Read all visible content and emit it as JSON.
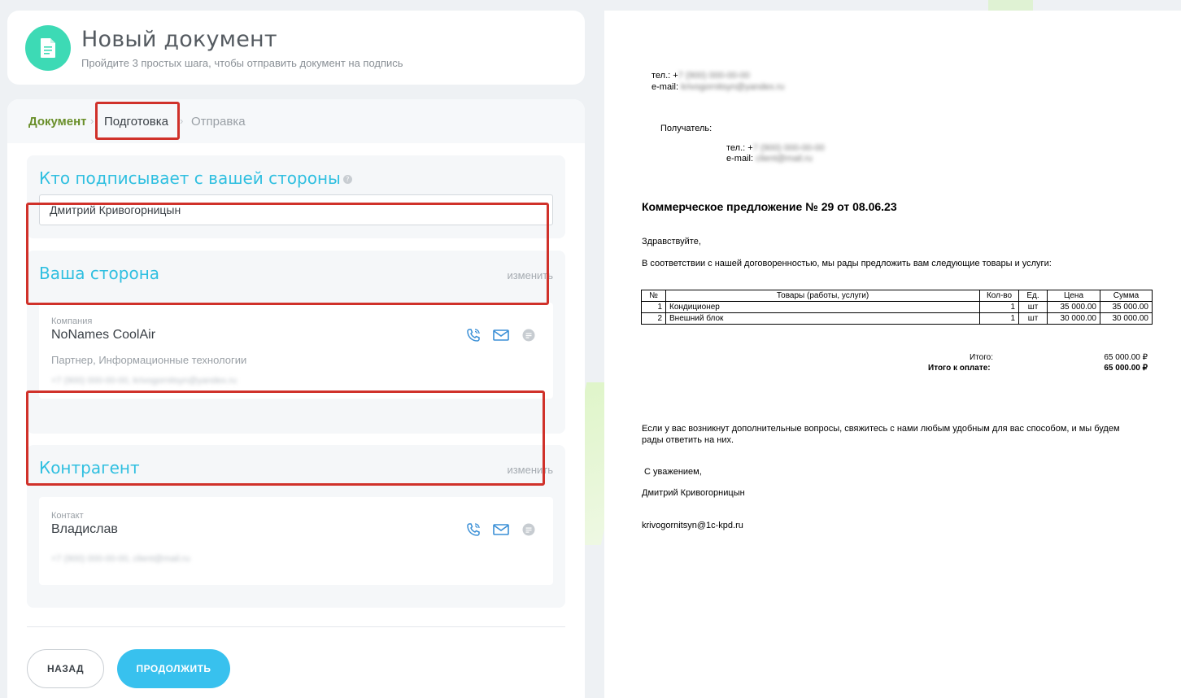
{
  "header": {
    "title": "Новый документ",
    "subtitle": "Пройдите 3 простых шага, чтобы отправить документ на подпись"
  },
  "tabs": [
    {
      "label": "Документ",
      "state": "done"
    },
    {
      "label": "Подготовка",
      "state": "active"
    },
    {
      "label": "Отправка",
      "state": "pending"
    }
  ],
  "tab_separator": "›",
  "signer": {
    "title": "Кто подписывает с вашей стороны",
    "help_icon": "?",
    "value": "Дмитрий Кривогорницын"
  },
  "our_side": {
    "title": "Ваша сторона",
    "change_label": "изменить",
    "type_label": "Компания",
    "name": "NoNames CoolAir",
    "role": "Партнер, Информационные технологии",
    "contact": "+7 (900) 000-00-00, krivogornitsyn@yandex.ru"
  },
  "counterparty": {
    "title": "Контрагент",
    "change_label": "изменить",
    "type_label": "Контакт",
    "name": "Владислав",
    "contact": "+7 (900) 000-00-00, client@mail.ru"
  },
  "buttons": {
    "back": "НАЗАД",
    "next": "ПРОДОЛЖИТЬ"
  },
  "icons": [
    "document-icon",
    "phone-icon",
    "mail-icon",
    "chat-icon"
  ],
  "colors": {
    "accent_cyan": "#38c1ee",
    "title_cyan": "#2fbfe0",
    "done_green": "#6a8f2a",
    "icon_teal": "#3ddab5",
    "highlight_red": "#d0312a"
  },
  "document": {
    "phone_label": "тел.: +",
    "phone_value": "7 (900) 000-00-00",
    "email_label": "e-mail:",
    "email_value": "krivogornitsyn@yandex.ru",
    "recipient_label": "Получатель:",
    "recipient_phone_label": "тел.: +",
    "recipient_phone_value": "7 (900) 000-00-00",
    "recipient_email_label": "e-mail:",
    "recipient_email_value": "client@mail.ru",
    "title": "Коммерческое предложение № 29 от 08.06.23",
    "greeting": "Здравствуйте,",
    "intro": "В соответствии с нашей договоренностью, мы рады предложить вам следующие товары и услуги:",
    "table": {
      "headers": [
        "№",
        "Товары (работы, услуги)",
        "Кол-во",
        "Ед.",
        "Цена",
        "Сумма"
      ],
      "rows": [
        [
          "1",
          "Кондиционер",
          "1",
          "шт",
          "35 000.00",
          "35 000.00"
        ],
        [
          "2",
          "Внешний блок",
          "1",
          "шт",
          "30 000.00",
          "30 000.00"
        ]
      ]
    },
    "total_label": "Итого:",
    "total_value": "65 000.00 ₽",
    "to_pay_label": "Итого к оплате:",
    "to_pay_value": "65 000.00 ₽",
    "closing": "Если у вас возникнут дополнительные вопросы, свяжитесь с нами любым удобным для вас способом, и мы будем рады ответить на них.",
    "regards": "С уважением,",
    "signer_name": "Дмитрий Кривогорницын",
    "signer_email": "krivogornitsyn@1c-kpd.ru"
  }
}
